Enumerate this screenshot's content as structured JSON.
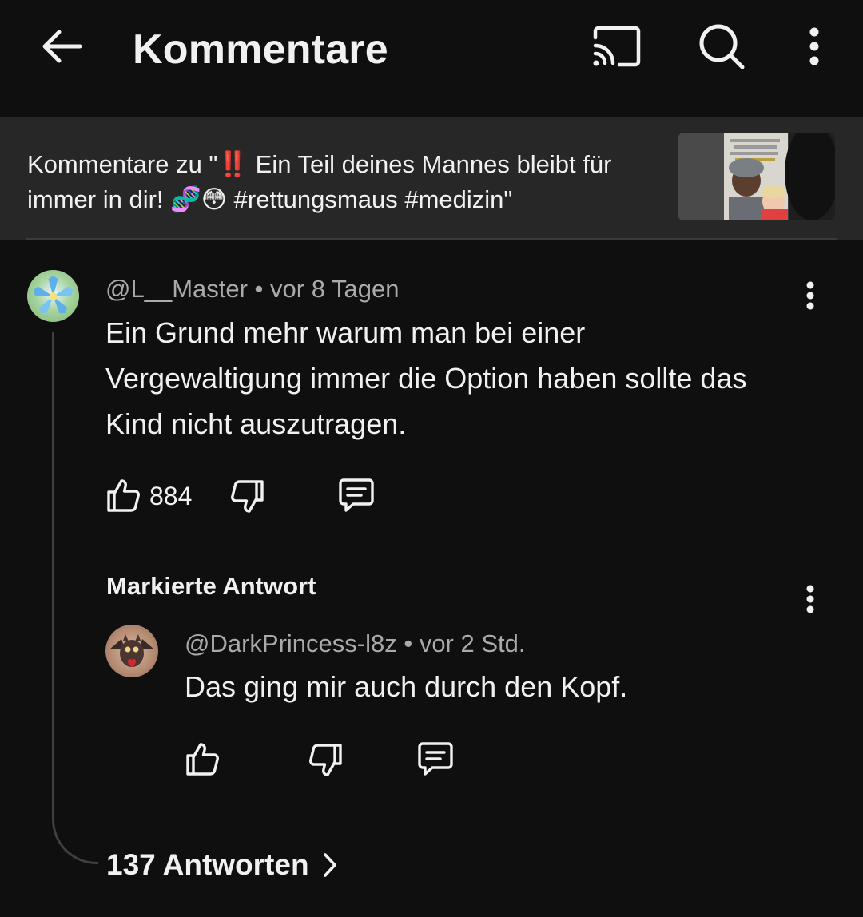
{
  "header": {
    "title": "Kommentare",
    "back_icon": "arrow-left-icon",
    "cast_icon": "cast-icon",
    "search_icon": "search-icon",
    "more_icon": "more-vertical-icon"
  },
  "video_context": {
    "text": "Kommentare zu \"‼️ Ein Teil deines Mannes bleibt für immer in dir! 🧬😳 #rettungsmaus #medizin\""
  },
  "comment": {
    "meta": "@L__Master • vor 8 Tagen",
    "text": "Ein Grund mehr warum man bei einer Vergewaltigung immer die Option haben sollte das Kind nicht auszutragen.",
    "likes": "884"
  },
  "highlighted_reply": {
    "label": "Markierte Antwort",
    "meta": "@DarkPrincess-l8z • vor 2 Std.",
    "text": "Das ging mir auch durch den Kopf."
  },
  "replies_link": {
    "label": "137 Antworten"
  },
  "colors": {
    "background": "#0f0f0f",
    "context_bar": "#272727",
    "text_primary": "#f1f1f1",
    "text_secondary": "#aaaaaa",
    "thread_line": "#3f3f3f"
  }
}
